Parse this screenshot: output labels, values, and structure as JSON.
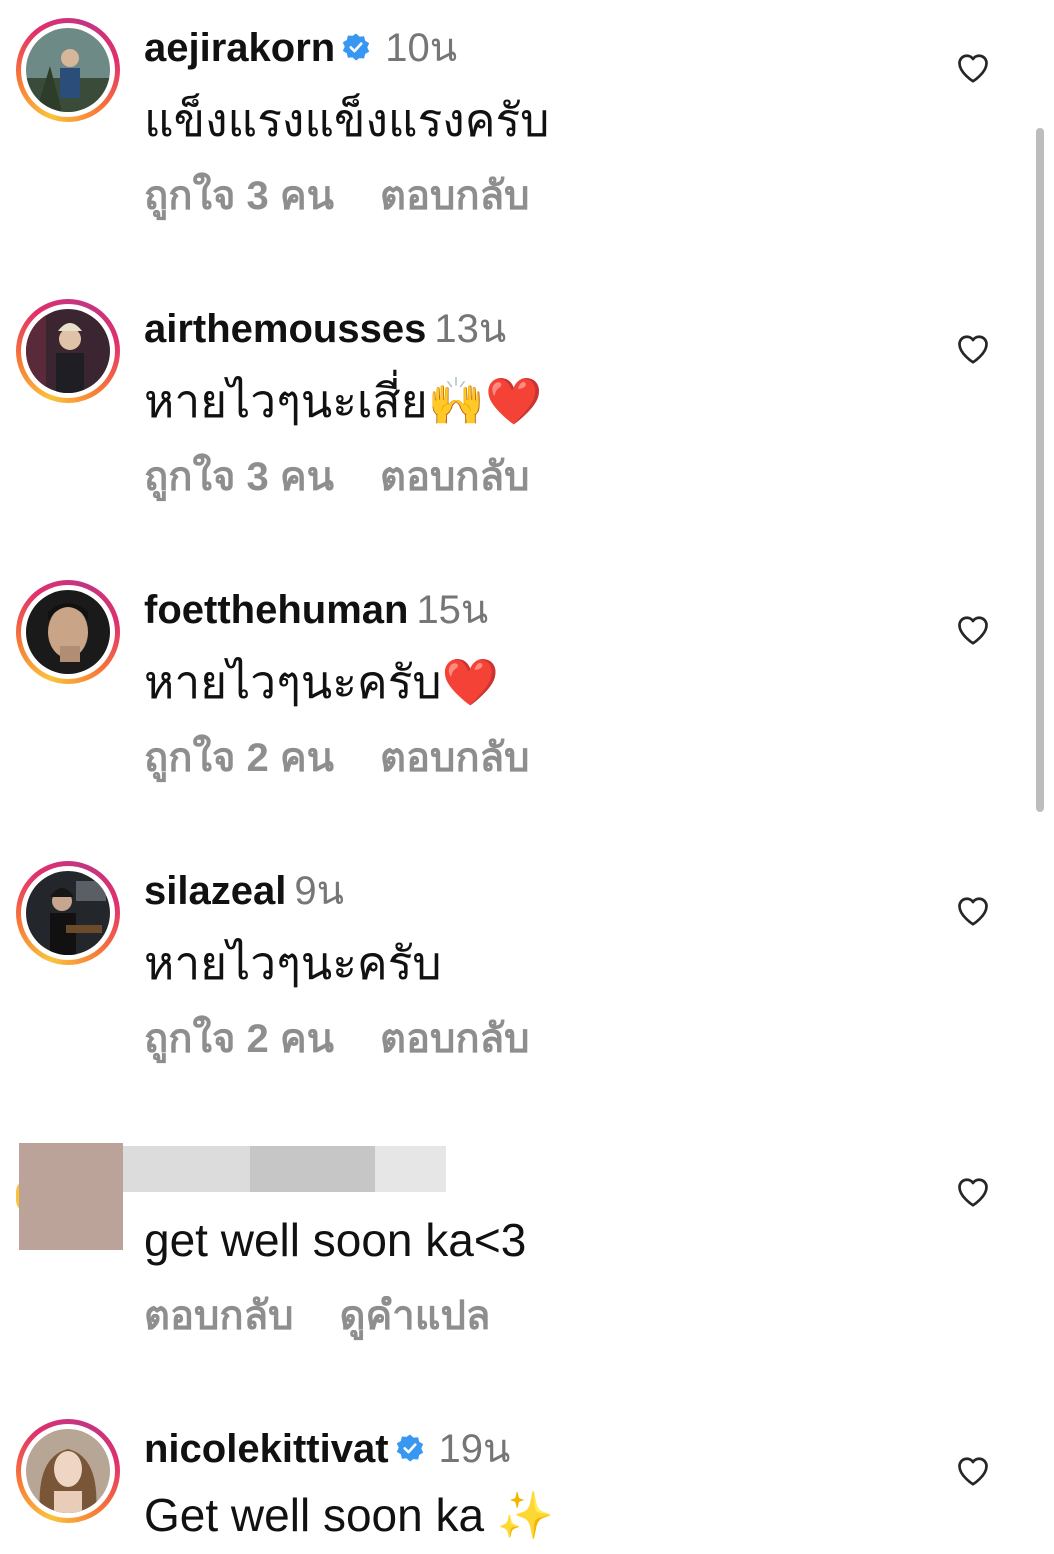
{
  "comments": [
    {
      "username": "aejirakorn",
      "verified": true,
      "time": "10น",
      "text": "แข็งแรงแข็งแรงครับ",
      "emoji": "",
      "likes": "ถูกใจ 3 คน",
      "reply": "ตอบกลับ"
    },
    {
      "username": "airthemousses",
      "verified": false,
      "time": "13น",
      "text": "หายไวๆนะเสี่ย",
      "emoji": "🙌❤️",
      "likes": "ถูกใจ 3 คน",
      "reply": "ตอบกลับ"
    },
    {
      "username": "foetthehuman",
      "verified": false,
      "time": "15น",
      "text": "หายไวๆนะครับ",
      "emoji": "❤️",
      "likes": "ถูกใจ 2 คน",
      "reply": "ตอบกลับ"
    },
    {
      "username": "silazeal",
      "verified": false,
      "time": "9น",
      "text": "หายไวๆนะครับ",
      "emoji": "",
      "likes": "ถูกใจ 2 คน",
      "reply": "ตอบกลับ"
    },
    {
      "username": "",
      "verified": false,
      "time": "",
      "text": "get well soon ka<3",
      "emoji": "",
      "reply": "ตอบกลับ",
      "translate": "ดูคำแปล"
    },
    {
      "username": "nicolekittivat",
      "verified": true,
      "time": "19น",
      "text": "Get well soon ka",
      "emoji": "✨"
    }
  ],
  "colors": {
    "verified": "#3897f0",
    "secondary_text": "#8e8e8e",
    "heart_outline": "#262626"
  },
  "icons": {
    "like": "heart-outline-icon",
    "verified": "verified-badge-icon"
  }
}
